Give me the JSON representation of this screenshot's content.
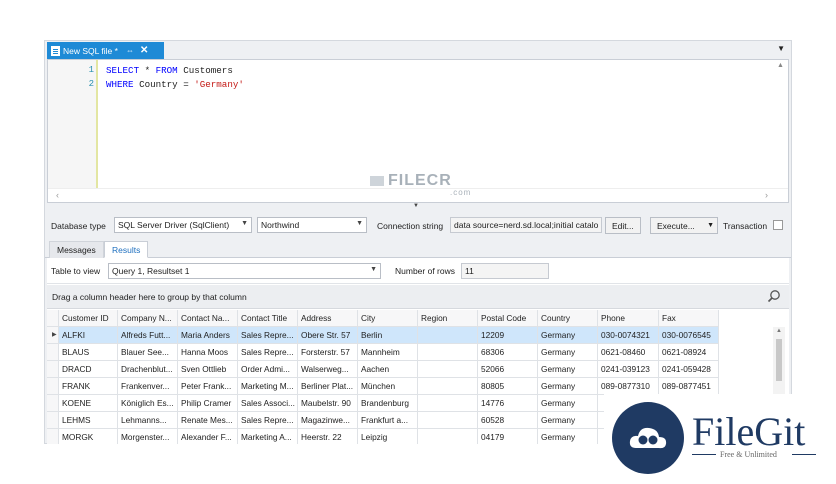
{
  "document_tab": {
    "title": "New SQL file *",
    "pin": "⇔",
    "close": "✕"
  },
  "editor": {
    "line_numbers": [
      "1",
      "2"
    ],
    "line1": {
      "kw1": "SELECT",
      "rest": " * ",
      "kw2": "FROM",
      "table": " Customers"
    },
    "line2": {
      "kw": "WHERE",
      "rest": " Country = ",
      "str": "'Germany'"
    }
  },
  "connection": {
    "database_type_label": "Database type",
    "database_type_value": "SQL Server Driver (SqlClient)",
    "database_value": "Northwind",
    "connection_string_label": "Connection string",
    "connection_string_value": "data source=nerd.sd.local;initial catalo",
    "edit_button": "Edit...",
    "execute_button": "Execute...",
    "transaction_label": "Transaction"
  },
  "result_tabs": [
    "Messages",
    "Results"
  ],
  "results": {
    "table_to_view_label": "Table to view",
    "table_to_view_value": "Query 1, Resultset 1",
    "number_of_rows_label": "Number of rows",
    "number_of_rows_value": "11",
    "group_hint": "Drag a column header here to group by that column"
  },
  "grid": {
    "columns": [
      "Customer ID",
      "Company N...",
      "Contact Na...",
      "Contact Title",
      "Address",
      "City",
      "Region",
      "Postal Code",
      "Country",
      "Phone",
      "Fax"
    ],
    "rows": [
      [
        "ALFKI",
        "Alfreds Futt...",
        "Maria Anders",
        "Sales Repre...",
        "Obere Str. 57",
        "Berlin",
        "",
        "12209",
        "Germany",
        "030-0074321",
        "030-0076545"
      ],
      [
        "BLAUS",
        "Blauer See...",
        "Hanna Moos",
        "Sales Repre...",
        "Forsterstr. 57",
        "Mannheim",
        "",
        "68306",
        "Germany",
        "0621-08460",
        "0621-08924"
      ],
      [
        "DRACD",
        "Drachenblut...",
        "Sven Ottlieb",
        "Order Admi...",
        "Walserweg...",
        "Aachen",
        "",
        "52066",
        "Germany",
        "0241-039123",
        "0241-059428"
      ],
      [
        "FRANK",
        "Frankenver...",
        "Peter Frank...",
        "Marketing M...",
        "Berliner Plat...",
        "München",
        "",
        "80805",
        "Germany",
        "089-0877310",
        "089-0877451"
      ],
      [
        "KOENE",
        "Königlich Es...",
        "Philip Cramer",
        "Sales Associ...",
        "Maubelstr. 90",
        "Brandenburg",
        "",
        "14776",
        "Germany",
        "",
        ""
      ],
      [
        "LEHMS",
        "Lehmanns...",
        "Renate Mes...",
        "Sales Repre...",
        "Magazinwe...",
        "Frankfurt a...",
        "",
        "60528",
        "Germany",
        "",
        ""
      ],
      [
        "MORGK",
        "Morgenster...",
        "Alexander F...",
        "Marketing A...",
        "Heerstr. 22",
        "Leipzig",
        "",
        "04179",
        "Germany",
        "",
        ""
      ]
    ]
  },
  "watermarks": {
    "filecr": "FILECR",
    "filecr_domain": ".com",
    "filegit": "FileGit",
    "filegit_tag": "Free & Unlimited"
  }
}
